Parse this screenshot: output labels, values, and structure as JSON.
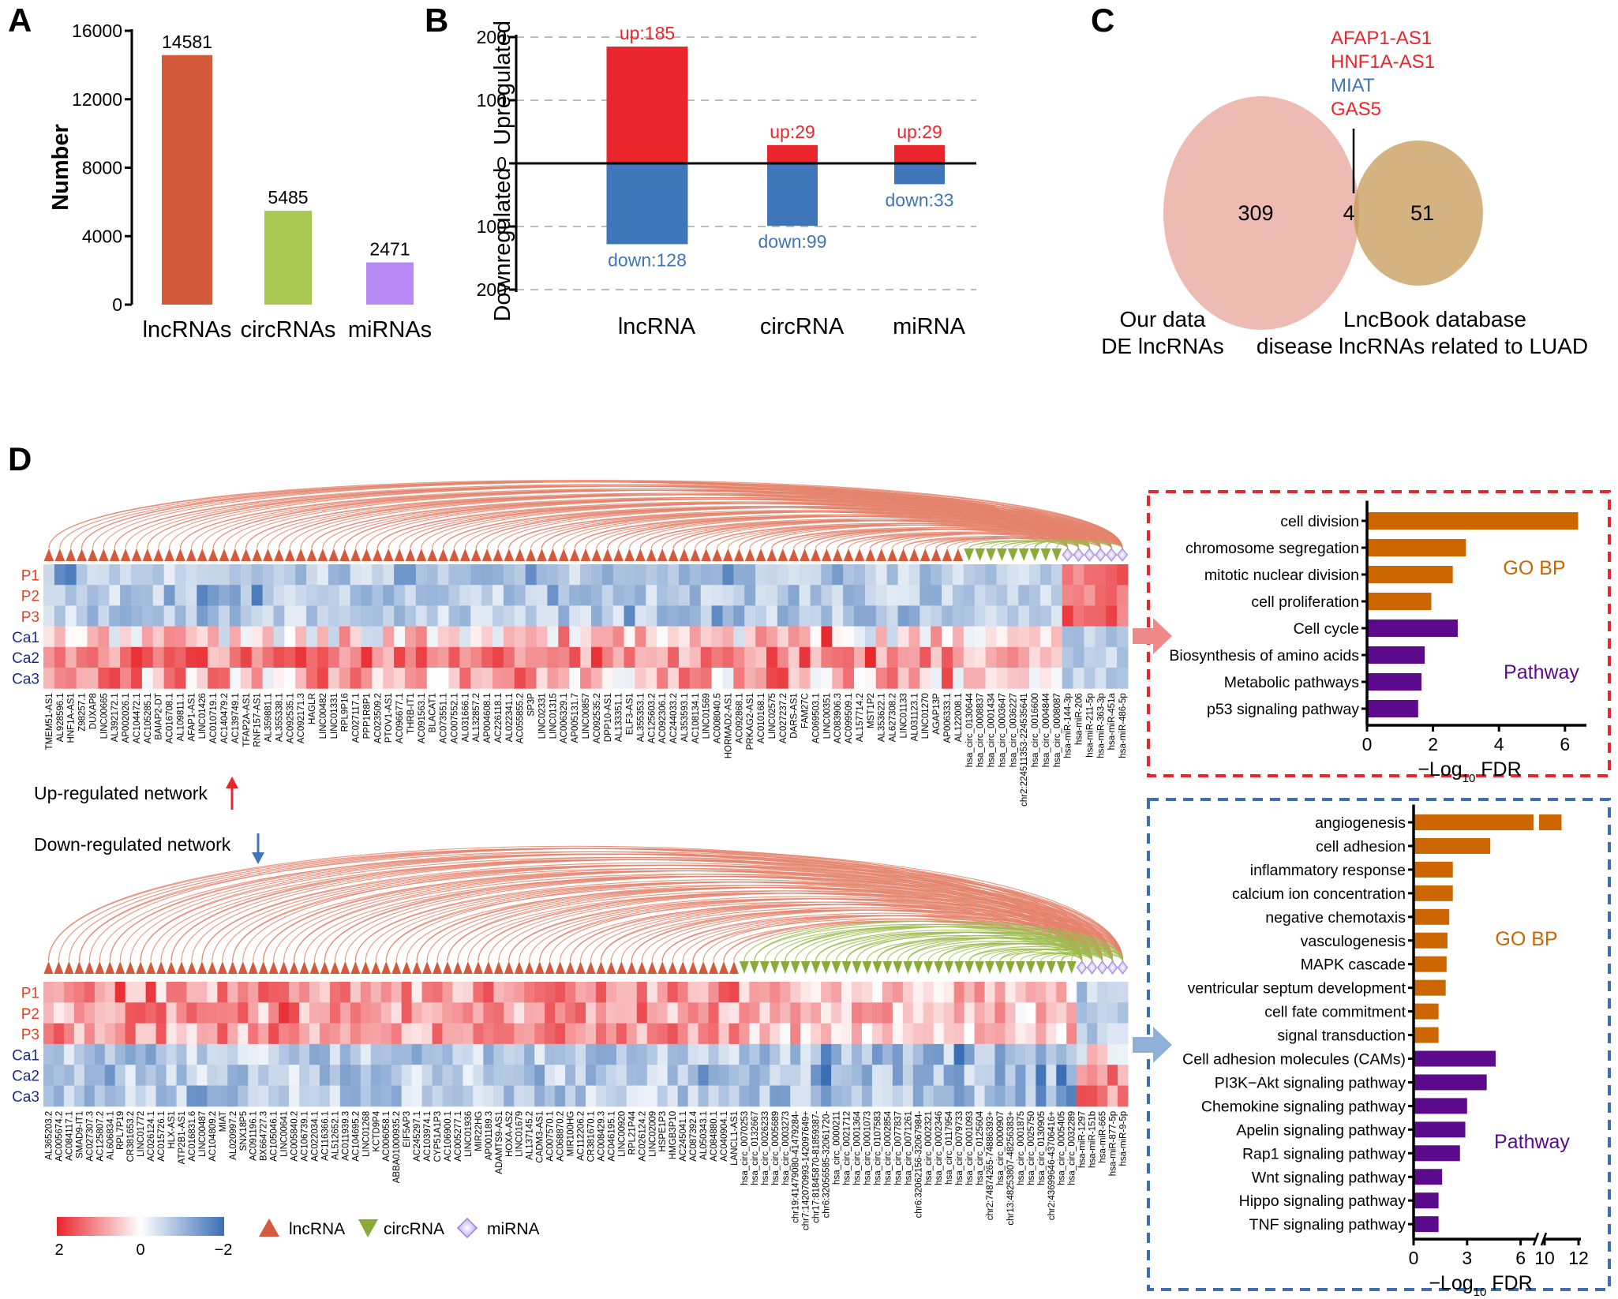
{
  "panels": {
    "a": "A",
    "b": "B",
    "c": "C",
    "d": "D"
  },
  "colors": {
    "lncRNA_bar": "#d35b3c",
    "circRNA_bar": "#a8c852",
    "miRNA_bar": "#b98af6",
    "up": "#e8262b",
    "down": "#3f76b9",
    "go_bp": "#cc6600",
    "pathway": "#5a0a8a",
    "heat_high": "#e8262b",
    "heat_mid": "#ffffff",
    "heat_low": "#3a6fb5",
    "lncRNA_node": "#d35b3c",
    "circRNA_node": "#8aab3a",
    "miRNA_node": "#c6b3f2",
    "venn_left": "#e49687",
    "venn_right": "#c49650",
    "up_box": "#e8262b",
    "down_box": "#3a6fb5"
  },
  "chart_data": [
    {
      "panel": "A",
      "type": "bar",
      "categories": [
        "lncRNAs",
        "circRNAs",
        "miRNAs"
      ],
      "values": [
        14581,
        5485,
        2471
      ],
      "value_labels": [
        "14581",
        "5485",
        "2471"
      ],
      "ylabel": "Number",
      "ylim": [
        0,
        16000
      ],
      "yticks": [
        "0",
        "4000",
        "8000",
        "12000",
        "16000"
      ],
      "ytick_values": [
        0,
        4000,
        8000,
        12000,
        16000
      ]
    },
    {
      "panel": "B",
      "type": "bar",
      "categories": [
        "lncRNA",
        "circRNA",
        "miRNA"
      ],
      "series": [
        {
          "name": "up",
          "values": [
            185,
            29,
            29
          ],
          "labels": [
            "up:185",
            "up:29",
            "up:29"
          ]
        },
        {
          "name": "down",
          "values": [
            128,
            99,
            33
          ],
          "labels": [
            "down:128",
            "down:99",
            "down:33"
          ]
        }
      ],
      "ylabel_up": "Upregulated",
      "ylabel_down": "Downregulated",
      "ylim": [
        -200,
        200
      ],
      "yticks": [
        "200",
        "100",
        "0",
        "100",
        "200"
      ],
      "ytick_values": [
        200,
        100,
        0,
        -100,
        -200
      ],
      "grid": "dashed"
    },
    {
      "panel": "C",
      "type": "venn",
      "sets": [
        {
          "label_lines": [
            "Our data",
            "DE lncRNAs"
          ],
          "only": "309"
        },
        {
          "label_lines": [
            "LncBook database",
            "disease lncRNAs related to LUAD"
          ],
          "only": "51"
        }
      ],
      "intersection": "4",
      "intersection_genes": [
        {
          "name": "AFAP1-AS1",
          "status": "up"
        },
        {
          "name": "HNF1A-AS1",
          "status": "up"
        },
        {
          "name": "MIAT",
          "status": "down"
        },
        {
          "name": "GAS5",
          "status": "up"
        }
      ]
    },
    {
      "panel": "D",
      "type": "heatmap",
      "title": "Up-regulated network",
      "rows": [
        "P1",
        "P2",
        "P3",
        "Ca1",
        "Ca2",
        "Ca3"
      ],
      "row_groups": [
        "P",
        "P",
        "P",
        "Ca",
        "Ca",
        "Ca"
      ],
      "color_range": [
        -2,
        2
      ],
      "lncRNA": [
        "TMEM51-AS1",
        "AL928596.1",
        "HNF1A-AS1",
        "Z98257.1",
        "DUXAP8",
        "LINC00665",
        "AL392172.1",
        "AP002026.1",
        "AC104472.1",
        "AC105285.1",
        "BAIAP2-DT",
        "AC016708.1",
        "AL109811.1",
        "AFAP1-AS1",
        "LINC01426",
        "AC010719.1",
        "AC140479.2",
        "AC139749.1",
        "TFAP2A-AS1",
        "RNF157-AS1",
        "AL359881.1",
        "AL355338.1",
        "AC092535.1",
        "AC092171.3",
        "HAGLR",
        "LINC00482",
        "LINC01331",
        "RPL9P16",
        "AC027117.1",
        "PPP1R8P1",
        "AC023509.2",
        "PTOV1-AS1",
        "AC096677.1",
        "THRB-IT1",
        "AC091563.1",
        "BLACAT1",
        "AC073551.1",
        "AC007552.1",
        "AL031666.1",
        "AL132857.2",
        "AP004608.1",
        "AC226118.1",
        "AL022341.1",
        "AC055855.2",
        "SP3P",
        "LINC02331",
        "LINC01315",
        "AC006329.1",
        "AP005131.7",
        "LINC00857",
        "AC092535.2",
        "DPP10-AS1",
        "AL133351.1",
        "ELF3-AS1",
        "AL355353.1",
        "AC125603.2",
        "AC092306.1",
        "AC244033.2",
        "AL353593.1",
        "AC108134.1",
        "LINC01569",
        "AC008040.5",
        "HORMAD2-AS1",
        "AC092868.1",
        "PRKAG2-AS1",
        "AC010168.1",
        "LINC02575",
        "AC027237.2",
        "DARS-AS1",
        "FAM27C",
        "AC069503.1",
        "LINC00351",
        "AC083906.3",
        "AC099509.1",
        "AL157714.2",
        "MST1P2",
        "AL353622.1",
        "AL627308.2",
        "LINC01133",
        "AL031123.1",
        "LINC01270",
        "AGAP13P",
        "AP006333.1",
        "AL122008.1"
      ],
      "circRNA": [
        "hsa_circ_0130644",
        "hsa_circ_0008837",
        "hsa_circ_0001434",
        "hsa_circ_0003647",
        "hsa_circ_0036227",
        "chr2:224511353-224535641",
        "hsa_circ_0016600",
        "hsa_circ_0004844",
        "hsa_circ_0008087"
      ],
      "miRNA": [
        "hsa-miR-144-3p",
        "hsa-miR-206",
        "hsa-miR-211-5p",
        "hsa-miR-363-3p",
        "hsa-miR-451a",
        "hsa-miR-486-5p"
      ]
    },
    {
      "panel": "D",
      "type": "heatmap",
      "title": "Down-regulated network",
      "rows": [
        "P1",
        "P2",
        "P3",
        "Ca1",
        "Ca2",
        "Ca3"
      ],
      "row_groups": [
        "P",
        "P",
        "P",
        "Ca",
        "Ca",
        "Ca"
      ],
      "color_range": [
        -2,
        2
      ],
      "lncRNA": [
        "AL365203.2",
        "AC005674.2",
        "AC084117.1",
        "SMAD9-IT1",
        "AC027307.3",
        "AC125807.2",
        "AL606834.1",
        "RPL7P19",
        "CR381653.2",
        "LINC01772",
        "AC026124.1",
        "AC015726.1",
        "HLX-AS1",
        "ATP2B1-AS1",
        "AC016831.6",
        "LINC00487",
        "AC104809.2",
        "MIAT",
        "AL020997.2",
        "SNX18P5",
        "AC091196.1",
        "BX664727.3",
        "AC105046.1",
        "LINC00641",
        "AC005840.2",
        "AC106739.1",
        "AC022034.1",
        "AC116366.1",
        "AL512652.1",
        "AC011939.3",
        "AC104695.2",
        "LINC01268",
        "KCTD9P4",
        "AC006058.1",
        "ABBA01000935.2",
        "EIF5AP3",
        "AC245297.1",
        "AC103974.1",
        "CYP51A1P3",
        "AC106900.1",
        "AC005277.1",
        "LINC01936",
        "MIR22HG",
        "AP001189.3",
        "ADAMTS9-AS1",
        "HOXA-AS2",
        "LINC01679",
        "AL137145.2",
        "CADM3-AS1",
        "AC007570.1",
        "AC068870.2",
        "MIR100HG",
        "AC112206.2",
        "CR381670.1",
        "AC008429.3",
        "AC046195.1",
        "LINC00920",
        "RPL21P44",
        "AC026124.2",
        "LINC02009",
        "HSPE1P3",
        "HMGB3P10",
        "AC245041.1",
        "AC087392.4",
        "AL050343.1",
        "AC084880.1",
        "AC040904.1",
        "LANCL1-AS1"
      ],
      "circRNA": [
        "hsa_circ_0070253",
        "hsa_circ_0132667",
        "hsa_circ_0026233",
        "hsa_circ_0005689",
        "hsa_circ_0003273",
        "chr19:41479080-41479284-",
        "chr7:142070993-142097649+",
        "chr17:81845870-81859387-",
        "chr6:32056585-32061720-",
        "hsa_circ_0000211",
        "hsa_circ_0021712",
        "hsa_circ_0001364",
        "hsa_circ_0001073",
        "hsa_circ_0107583",
        "hsa_circ_0002854",
        "hsa_circ_0077837",
        "hsa_circ_0071261",
        "chr6:32062156-32067984-",
        "hsa_circ_0002321",
        "hsa_circ_0002346",
        "hsa_circ_0117954",
        "hsa_circ_0079733",
        "hsa_circ_0001093",
        "hsa_circ_0125604",
        "chr2:74874265-74886393+",
        "hsa_circ_0000907",
        "chr13:48253807-48256383+",
        "hsa_circ_0001875",
        "hsa_circ_0025750",
        "hsa_circ_0130905",
        "chr2:43699646-43706416+",
        "hsa_circ_0005405",
        "hsa_circ_0032289"
      ],
      "miRNA": [
        "hsa-miR-1297",
        "hsa-miR-151b",
        "hsa-miR-665",
        "hsa-miR-877-5p",
        "hsa-miR-9-5p"
      ]
    },
    {
      "type": "bar",
      "orientation": "horizontal",
      "network": "up",
      "categories": [
        "cell division",
        "chromosome segregation",
        "mitotic nuclear division",
        "cell proliferation",
        "Cell cycle",
        "Biosynthesis of amino acids",
        "Metabolic pathways",
        "p53 signaling pathway"
      ],
      "values": [
        6.4,
        3.0,
        2.6,
        1.95,
        2.75,
        1.75,
        1.65,
        1.55
      ],
      "groups": [
        "GO BP",
        "GO BP",
        "GO BP",
        "GO BP",
        "Pathway",
        "Pathway",
        "Pathway",
        "Pathway"
      ],
      "group_labels": [
        "GO BP",
        "Pathway"
      ],
      "xlabel": {
        "main": "−Log",
        "sub": "10",
        "tail": " FDR"
      },
      "xlim": [
        0,
        6.6
      ],
      "xticks": [
        "0",
        "2",
        "4",
        "6"
      ],
      "xtick_values": [
        0,
        2,
        4,
        6
      ]
    },
    {
      "type": "bar",
      "orientation": "horizontal",
      "network": "down",
      "categories": [
        "angiogenesis",
        "cell adhesion",
        "inflammatory response",
        "calcium ion concentration",
        "negative chemotaxis",
        "vasculogenesis",
        "MAPK cascade",
        "ventricular septum development",
        "cell fate commitment",
        "signal transduction",
        "Cell adhesion molecules (CAMs)",
        "PI3K−Akt signaling pathway",
        "Chemokine signaling pathway",
        "Apelin signaling pathway",
        "Rap1 signaling pathway",
        "Wnt signaling pathway",
        "Hippo signaling pathway",
        "TNF signaling pathway"
      ],
      "values": [
        11.0,
        4.3,
        2.2,
        2.2,
        2.0,
        1.9,
        1.85,
        1.8,
        1.4,
        1.4,
        4.6,
        4.1,
        3.0,
        2.9,
        2.6,
        1.6,
        1.4,
        1.4
      ],
      "groups": [
        "GO BP",
        "GO BP",
        "GO BP",
        "GO BP",
        "GO BP",
        "GO BP",
        "GO BP",
        "GO BP",
        "GO BP",
        "GO BP",
        "Pathway",
        "Pathway",
        "Pathway",
        "Pathway",
        "Pathway",
        "Pathway",
        "Pathway",
        "Pathway"
      ],
      "group_labels": [
        "GO BP",
        "Pathway"
      ],
      "xlabel": {
        "main": "−Log",
        "sub": "10",
        "tail": " FDR"
      },
      "axis_break": [
        6.9,
        9.7
      ],
      "xlim": [
        0,
        12
      ],
      "xticks": [
        "0",
        "3",
        "6",
        "10",
        "12"
      ],
      "xtick_values": [
        0,
        3,
        6,
        10,
        12
      ]
    }
  ],
  "network_labels": {
    "up": "Up-regulated network",
    "down": "Down-regulated network"
  },
  "legend": {
    "colorbar_ticks": [
      "2",
      "0",
      "−2"
    ],
    "items": [
      {
        "label": "lncRNA",
        "shape": "triangle-up"
      },
      {
        "label": "circRNA",
        "shape": "triangle-down"
      },
      {
        "label": "miRNA",
        "shape": "diamond"
      }
    ]
  }
}
